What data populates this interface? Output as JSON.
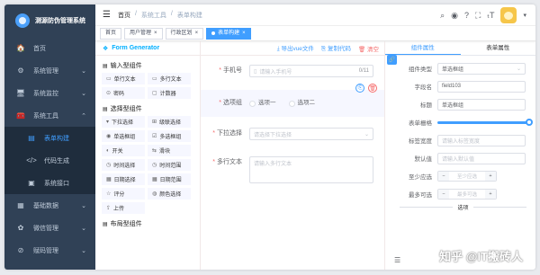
{
  "app": {
    "title": "测源防伪管理系统"
  },
  "sidebar": {
    "items": [
      {
        "icon": "🏠",
        "label": "首页"
      },
      {
        "icon": "⚙",
        "label": "系统管理",
        "arrow": "⌄"
      },
      {
        "icon": "🖥",
        "label": "系统监控",
        "arrow": "⌄"
      },
      {
        "icon": "🧰",
        "label": "系统工具",
        "arrow": "⌃"
      }
    ],
    "subitems": [
      {
        "icon": "▤",
        "label": "表单构建"
      },
      {
        "icon": "</>",
        "label": "代码生成"
      },
      {
        "icon": "▣",
        "label": "系统接口"
      }
    ],
    "bottom": [
      {
        "icon": "▦",
        "label": "基础数据",
        "arrow": "⌄"
      },
      {
        "icon": "✿",
        "label": "微信管理",
        "arrow": "⌄"
      },
      {
        "icon": "⊘",
        "label": "赋码管理",
        "arrow": "⌄"
      }
    ]
  },
  "header": {
    "breadcrumb": [
      "首页",
      "/",
      "系统工具",
      "/",
      "表单构建"
    ],
    "icons": {
      "search": "⌕",
      "github": "◉",
      "help": "?",
      "fullscreen": "⛶",
      "size": "ₜT"
    },
    "caret": "▾"
  },
  "tags": [
    {
      "label": "首页"
    },
    {
      "label": "用户管理",
      "close": "×"
    },
    {
      "label": "行政区划",
      "close": "×"
    },
    {
      "label": "表单构建",
      "close": "×"
    }
  ],
  "palette": {
    "title": "Form Generator",
    "groups": [
      {
        "label": "输入型组件",
        "items": [
          {
            "icon": "▭",
            "label": "单行文本"
          },
          {
            "icon": "▭",
            "label": "多行文本"
          },
          {
            "icon": "⊙",
            "label": "密码"
          },
          {
            "icon": "▢",
            "label": "计数器"
          }
        ]
      },
      {
        "label": "选择型组件",
        "items": [
          {
            "icon": "▾",
            "label": "下拉选择"
          },
          {
            "icon": "⊞",
            "label": "级联选择"
          },
          {
            "icon": "◉",
            "label": "单选框组"
          },
          {
            "icon": "☑",
            "label": "多选框组"
          },
          {
            "icon": "◐",
            "label": "开关"
          },
          {
            "icon": "⇆",
            "label": "滑块"
          },
          {
            "icon": "◷",
            "label": "时间选择"
          },
          {
            "icon": "◷",
            "label": "时间范围"
          },
          {
            "icon": "▦",
            "label": "日期选择"
          },
          {
            "icon": "▦",
            "label": "日期范围"
          },
          {
            "icon": "☆",
            "label": "评分"
          },
          {
            "icon": "◍",
            "label": "颜色选择"
          },
          {
            "icon": "⇪",
            "label": "上传"
          }
        ]
      },
      {
        "label": "布局型组件",
        "items": []
      }
    ]
  },
  "toolbar": {
    "export": "导出vue文件",
    "copy": "复制代码",
    "clear": "清空"
  },
  "form": {
    "phone": {
      "label": "手机号",
      "placeholder": "请输入手机号",
      "count": "0/11"
    },
    "radio": {
      "label": "选项组",
      "options": [
        "选项一",
        "选项二"
      ]
    },
    "select": {
      "label": "下拉选择",
      "placeholder": "请选择下拉选择"
    },
    "textarea": {
      "label": "多行文本",
      "placeholder": "请输入多行文本"
    },
    "required_mark": "*",
    "actions": {
      "copy": "⎘",
      "delete": "🗑"
    }
  },
  "props": {
    "tabs": [
      "组件属性",
      "表单属性"
    ],
    "rows": {
      "type": {
        "label": "组件类型",
        "value": "单选框组"
      },
      "field": {
        "label": "字段名",
        "value": "field103"
      },
      "title": {
        "label": "标题",
        "value": "单选框组"
      },
      "span": {
        "label": "表单栅格"
      },
      "labelWidth": {
        "label": "标签宽度",
        "placeholder": "请输入标签宽度"
      },
      "default": {
        "label": "默认值",
        "placeholder": "请输入默认值"
      },
      "min": {
        "label": "至少应选",
        "placeholder": "至少应选"
      },
      "max": {
        "label": "最多可选",
        "placeholder": "最多可选"
      }
    },
    "span_value": 24,
    "divider": "选项"
  },
  "watermark": "知乎 @IT搬砖人"
}
